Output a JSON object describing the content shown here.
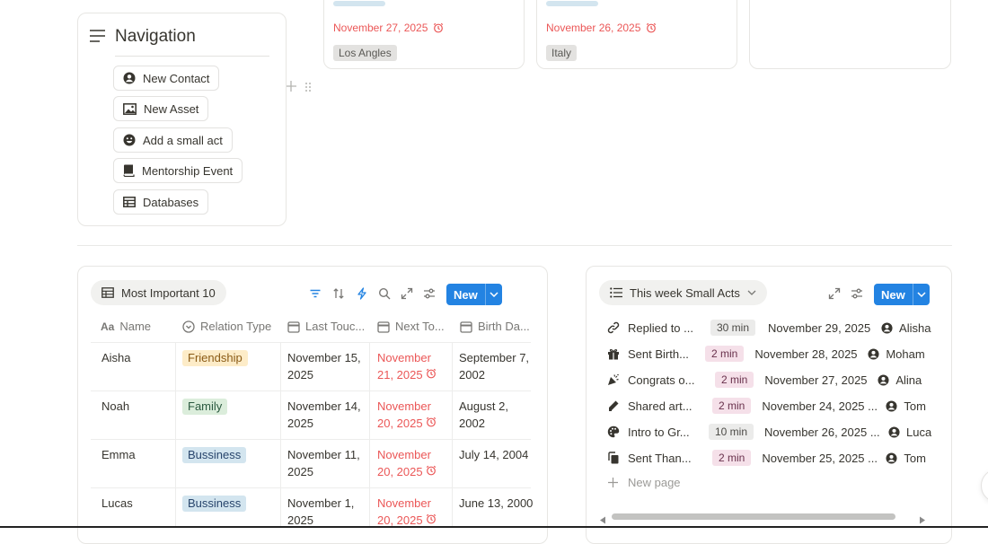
{
  "top_cards": [
    {
      "date": "November 27, 2025",
      "location": "Los Angles"
    },
    {
      "date": "November 26, 2025",
      "location": "Italy"
    }
  ],
  "navigation": {
    "title": "Navigation",
    "buttons": [
      {
        "label": "New Contact",
        "icon": "person-circle-icon"
      },
      {
        "label": "New Asset",
        "icon": "image-icon"
      },
      {
        "label": "Add a small act",
        "icon": "smiley-icon"
      },
      {
        "label": "Mentorship Event",
        "icon": "book-icon"
      },
      {
        "label": "Databases",
        "icon": "table-icon"
      }
    ]
  },
  "important": {
    "view_label": "Most Important 10",
    "new_label": "New",
    "columns": [
      "Name",
      "Relation Type",
      "Last Touc...",
      "Next To...",
      "Birth Da..."
    ],
    "rows": [
      {
        "name": "Aisha",
        "relation": "Friendship",
        "relation_color": "#fdecc8",
        "last_a": "November 15,",
        "last_b": "2025",
        "next_a": "November",
        "next_b": "21, 2025",
        "birth_a": "September 7,",
        "birth_b": "2002"
      },
      {
        "name": "Noah",
        "relation": "Family",
        "relation_color": "#dbeddb",
        "last_a": "November 14,",
        "last_b": "2025",
        "next_a": "November",
        "next_b": "20, 2025",
        "birth_a": "August 2,",
        "birth_b": "2002"
      },
      {
        "name": "Emma",
        "relation": "Bussiness",
        "relation_color": "#d3e5ef",
        "last_a": "November 11,",
        "last_b": "2025",
        "next_a": "November",
        "next_b": "20, 2025",
        "birth_a": "July 14, 2004",
        "birth_b": ""
      },
      {
        "name": "Lucas",
        "relation": "Bussiness",
        "relation_color": "#d3e5ef",
        "last_a": "November 1,",
        "last_b": "2025",
        "next_a": "November",
        "next_b": "20, 2025",
        "birth_a": "June 13, 2000",
        "birth_b": ""
      }
    ]
  },
  "small_acts": {
    "view_label": "This week Small Acts",
    "new_label": "New",
    "new_page": "New page",
    "rows": [
      {
        "icon": "link-icon",
        "title": "Replied to ...",
        "duration": "30 min",
        "date": "November 29, 2025",
        "person": "Alisha"
      },
      {
        "icon": "gift-icon",
        "title": "Sent Birth...",
        "duration": "2 min",
        "date": "November 28, 2025",
        "person": "Moham"
      },
      {
        "icon": "party-popper-icon",
        "title": "Congrats o...",
        "duration": "2 min",
        "date": "November 27, 2025",
        "person": "Alina"
      },
      {
        "icon": "pencil-icon",
        "title": "Shared art...",
        "duration": "2 min",
        "date": "November 24, 2025 ...",
        "person": "Tom"
      },
      {
        "icon": "palette-icon",
        "title": "Intro to Gr...",
        "duration": "10 min",
        "date": "November 26, 2025 ...",
        "person": "Luca"
      },
      {
        "icon": "copy-icon",
        "title": "Sent Than...",
        "duration": "2 min",
        "date": "November 25, 2025 ...",
        "person": "Tom"
      }
    ]
  }
}
